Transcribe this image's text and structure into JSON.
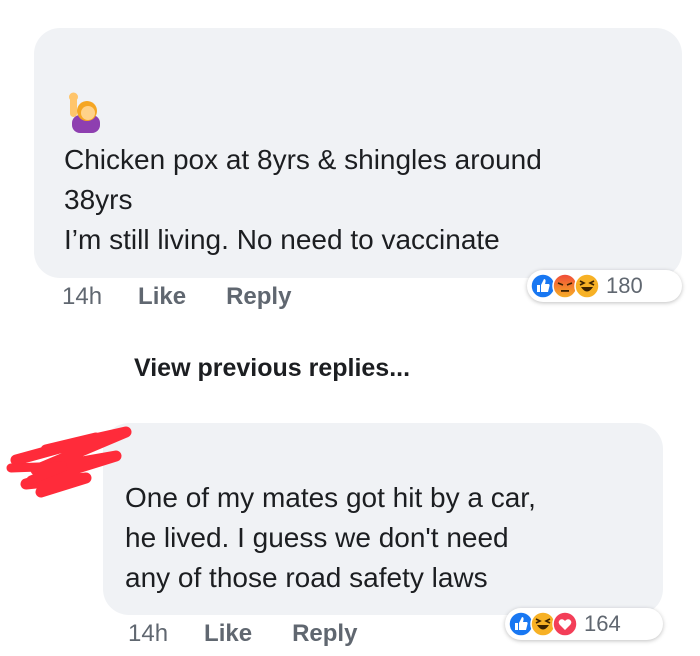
{
  "comment1": {
    "emoji": "person-raising-hand-icon",
    "text": "Chicken pox at 8yrs & shingles around\n38yrs\nI’m still living. No need to vaccinate",
    "time": "14h",
    "like_label": "Like",
    "reply_label": "Reply",
    "reactions": [
      "like-icon",
      "angry-icon",
      "haha-icon"
    ],
    "reaction_count": "180"
  },
  "view_previous_label": "View previous replies...",
  "comment2": {
    "avatar": "redacted",
    "text": "One of my mates got hit by a car,\nhe lived. I guess we don't need\nany of those road safety laws",
    "time": "14h",
    "like_label": "Like",
    "reply_label": "Reply",
    "reactions": [
      "like-icon",
      "haha-icon",
      "love-icon"
    ],
    "reaction_count": "164"
  },
  "colors": {
    "bubble": "#f0f2f5",
    "action_text": "#606770",
    "like_blue": "#1877f2",
    "angry_red": "#e9710f",
    "haha_yellow": "#f7b125",
    "love_red": "#f33e58",
    "redaction": "#ff2b3a"
  }
}
